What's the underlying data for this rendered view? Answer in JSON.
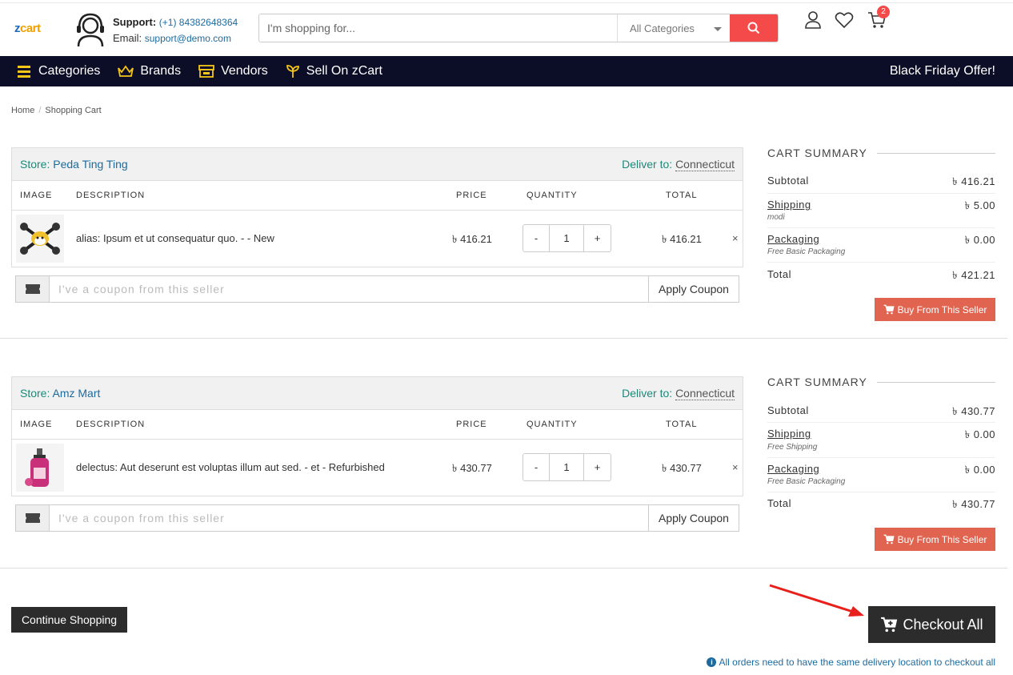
{
  "header": {
    "logo_z": "z",
    "logo_rest": "cart",
    "support_label": "Support:",
    "support_phone": "(+1) 84382648364",
    "email_label": "Email:",
    "email_value": "support@demo.com",
    "search_placeholder": "I'm shopping for...",
    "category_selected": "All Categories",
    "cart_count": "2"
  },
  "nav": {
    "items": [
      "Categories",
      "Brands",
      "Vendors",
      "Sell On zCart"
    ],
    "offer": "Black Friday Offer!"
  },
  "breadcrumb": {
    "home": "Home",
    "current": "Shopping Cart"
  },
  "columns": {
    "image": "IMAGE",
    "description": "DESCRIPTION",
    "price": "PRICE",
    "quantity": "QUANTITY",
    "total": "TOTAL"
  },
  "stores": [
    {
      "store_label": "Store:",
      "store_name": "Peda Ting Ting",
      "deliver_label": "Deliver to:",
      "deliver_value": "Connecticut",
      "item": {
        "description": "alias: Ipsum et ut consequatur quo. - - New",
        "price": "৳ 416.21",
        "qty_minus": "-",
        "qty": "1",
        "qty_plus": "+",
        "total": "৳ 416.21",
        "remove": "×"
      },
      "coupon_placeholder": "I've a coupon from this seller",
      "apply": "Apply Coupon",
      "summary": {
        "title": "CART SUMMARY",
        "subtotal_label": "Subtotal",
        "subtotal": "৳ 416.21",
        "shipping_label": "Shipping",
        "shipping_sub": "modi",
        "shipping": "৳ 5.00",
        "packaging_label": "Packaging",
        "packaging_sub": "Free Basic Packaging",
        "packaging": "৳ 0.00",
        "total_label": "Total",
        "total": "৳ 421.21",
        "buy": "Buy From This Seller"
      }
    },
    {
      "store_label": "Store:",
      "store_name": "Amz Mart",
      "deliver_label": "Deliver to:",
      "deliver_value": "Connecticut",
      "item": {
        "description": "delectus: Aut deserunt est voluptas illum aut sed. - et - Refurbished",
        "price": "৳ 430.77",
        "qty_minus": "-",
        "qty": "1",
        "qty_plus": "+",
        "total": "৳ 430.77",
        "remove": "×"
      },
      "coupon_placeholder": "I've a coupon from this seller",
      "apply": "Apply Coupon",
      "summary": {
        "title": "CART SUMMARY",
        "subtotal_label": "Subtotal",
        "subtotal": "৳ 430.77",
        "shipping_label": "Shipping",
        "shipping_sub": "Free Shipping",
        "shipping": "৳ 0.00",
        "packaging_label": "Packaging",
        "packaging_sub": "Free Basic Packaging",
        "packaging": "৳ 0.00",
        "total_label": "Total",
        "total": "৳ 430.77",
        "buy": "Buy From This Seller"
      }
    }
  ],
  "footer": {
    "continue": "Continue Shopping",
    "checkout": "Checkout All",
    "note": "All orders need to have the same delivery location to checkout all"
  },
  "colors": {
    "navbar": "#0c0e27",
    "accent_red": "#f54a4a",
    "buy_button": "#e06450",
    "dark_button": "#2c2c2c",
    "teal": "#1a8a7a",
    "link_blue": "#1d6b9e"
  }
}
